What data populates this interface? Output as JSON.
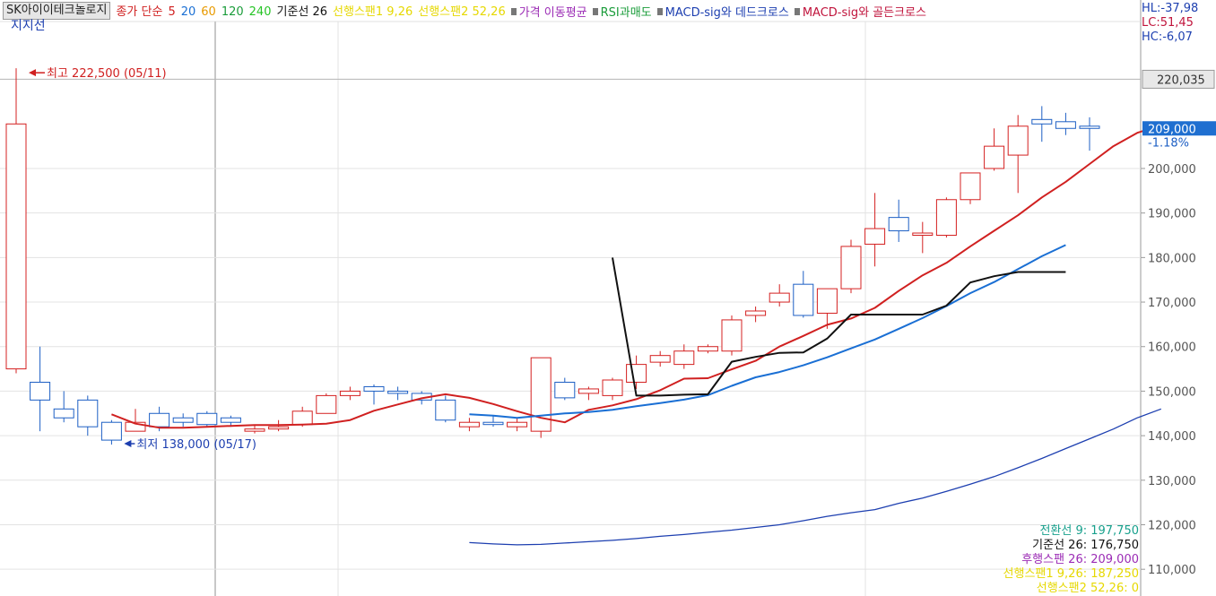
{
  "legend": {
    "title": "SK아이이테크놀로지",
    "items": [
      {
        "text": "종가 단순",
        "color": "#d02020"
      },
      {
        "text": "5",
        "color": "#d02020"
      },
      {
        "text": "20",
        "color": "#1a6fd4"
      },
      {
        "text": "60",
        "color": "#e89a00"
      },
      {
        "text": "120",
        "color": "#1a9c3a"
      },
      {
        "text": "240",
        "color": "#26c426"
      },
      {
        "text": "기준선 26",
        "color": "#111111"
      },
      {
        "text": "선행스팬1 9,26",
        "color": "#e6d800"
      },
      {
        "text": "선행스팬2 52,26",
        "color": "#e6d800"
      },
      {
        "text": "가격 이동평균",
        "color": "#9b2bb5",
        "marker": true
      },
      {
        "text": "RSI과매도",
        "color": "#1a9c3a",
        "marker": true
      },
      {
        "text": "MACD-sig와 데드크로스",
        "color": "#1d3fb0",
        "marker": true
      },
      {
        "text": "MACD-sig와 골든크로스",
        "color": "#c0143c",
        "marker": true
      }
    ]
  },
  "indicator_label": "지지선",
  "right_stats": [
    {
      "text": "HL:-37,98",
      "color": "#1d3fb0"
    },
    {
      "text": "LC:51,45",
      "color": "#c0143c"
    },
    {
      "text": "HC:-6,07",
      "color": "#1d3fb0"
    }
  ],
  "bottom_info": [
    {
      "text": "전환선 9: 197,750",
      "color": "#17a08c"
    },
    {
      "text": "기준선 26: 176,750",
      "color": "#111111"
    },
    {
      "text": "후행스팬 26: 209,000",
      "color": "#9b2bb5"
    },
    {
      "text": "선행스팬1 9,26: 187,250",
      "color": "#e6d800"
    },
    {
      "text": "선행스팬2 52,26: 0",
      "color": "#e6d800"
    }
  ],
  "chart_data": {
    "type": "candlestick",
    "yaxis": {
      "ticks": [
        "110,000",
        "120,000",
        "130,000",
        "140,000",
        "150,000",
        "160,000",
        "170,000",
        "180,000",
        "190,000",
        "200,000"
      ],
      "tick_values": [
        110000,
        120000,
        130000,
        140000,
        150000,
        160000,
        170000,
        180000,
        190000,
        200000
      ],
      "ylim": [
        104000,
        233000
      ],
      "max_marker": {
        "value": 220035,
        "label": "220,035"
      },
      "current": {
        "value": 209000,
        "label": "209,000",
        "change": "-1.18%"
      }
    },
    "annotations": {
      "high": {
        "text": "최고 222,500 (05/11)",
        "value": 222500,
        "index": 0
      },
      "low": {
        "text": "최저 138,000 (05/17)",
        "value": 138000,
        "index": 4
      }
    },
    "candles": [
      {
        "o": 155000,
        "h": 222500,
        "l": 154000,
        "c": 210000
      },
      {
        "o": 152000,
        "h": 160000,
        "l": 141000,
        "c": 148000
      },
      {
        "o": 146000,
        "h": 150000,
        "l": 143000,
        "c": 144000
      },
      {
        "o": 148000,
        "h": 149000,
        "l": 140000,
        "c": 142000
      },
      {
        "o": 143000,
        "h": 143500,
        "l": 138000,
        "c": 139000
      },
      {
        "o": 141000,
        "h": 146000,
        "l": 141000,
        "c": 143000
      },
      {
        "o": 145000,
        "h": 146500,
        "l": 141000,
        "c": 142000
      },
      {
        "o": 144000,
        "h": 145000,
        "l": 142000,
        "c": 143000
      },
      {
        "o": 145000,
        "h": 145500,
        "l": 142000,
        "c": 142500
      },
      {
        "o": 144000,
        "h": 144500,
        "l": 142000,
        "c": 143000
      },
      {
        "o": 141000,
        "h": 142500,
        "l": 140500,
        "c": 141500
      },
      {
        "o": 141500,
        "h": 143500,
        "l": 141000,
        "c": 142000
      },
      {
        "o": 142500,
        "h": 146500,
        "l": 142000,
        "c": 145500
      },
      {
        "o": 145000,
        "h": 149500,
        "l": 145000,
        "c": 149000
      },
      {
        "o": 149000,
        "h": 151000,
        "l": 148000,
        "c": 150000
      },
      {
        "o": 151000,
        "h": 151500,
        "l": 147000,
        "c": 150000
      },
      {
        "o": 150000,
        "h": 151000,
        "l": 148000,
        "c": 149500
      },
      {
        "o": 149500,
        "h": 150000,
        "l": 147000,
        "c": 148000
      },
      {
        "o": 148000,
        "h": 149000,
        "l": 143000,
        "c": 143500
      },
      {
        "o": 142000,
        "h": 144000,
        "l": 141000,
        "c": 143000
      },
      {
        "o": 143000,
        "h": 144500,
        "l": 142000,
        "c": 142500
      },
      {
        "o": 142000,
        "h": 144000,
        "l": 141000,
        "c": 143000
      },
      {
        "o": 141000,
        "h": 157500,
        "l": 139500,
        "c": 157500
      },
      {
        "o": 152000,
        "h": 153000,
        "l": 148000,
        "c": 148500
      },
      {
        "o": 149500,
        "h": 151000,
        "l": 148000,
        "c": 150500
      },
      {
        "o": 149000,
        "h": 153000,
        "l": 148000,
        "c": 152500
      },
      {
        "o": 152000,
        "h": 158000,
        "l": 150500,
        "c": 156000
      },
      {
        "o": 156500,
        "h": 159000,
        "l": 155500,
        "c": 158000
      },
      {
        "o": 156000,
        "h": 160500,
        "l": 155000,
        "c": 159000
      },
      {
        "o": 159000,
        "h": 160500,
        "l": 158500,
        "c": 160000
      },
      {
        "o": 159000,
        "h": 167000,
        "l": 158000,
        "c": 166000
      },
      {
        "o": 167000,
        "h": 169000,
        "l": 165500,
        "c": 168000
      },
      {
        "o": 170000,
        "h": 174000,
        "l": 169000,
        "c": 172000
      },
      {
        "o": 174000,
        "h": 177000,
        "l": 166500,
        "c": 167000
      },
      {
        "o": 167500,
        "h": 173000,
        "l": 164000,
        "c": 173000
      },
      {
        "o": 173000,
        "h": 184000,
        "l": 172000,
        "c": 182500
      },
      {
        "o": 183000,
        "h": 194500,
        "l": 178000,
        "c": 186500
      },
      {
        "o": 189000,
        "h": 193000,
        "l": 183500,
        "c": 186000
      },
      {
        "o": 185000,
        "h": 188000,
        "l": 181000,
        "c": 185500
      },
      {
        "o": 185000,
        "h": 193500,
        "l": 184500,
        "c": 193000
      },
      {
        "o": 193000,
        "h": 199000,
        "l": 192000,
        "c": 199000
      },
      {
        "o": 200000,
        "h": 209000,
        "l": 199500,
        "c": 205000
      },
      {
        "o": 203000,
        "h": 212000,
        "l": 194500,
        "c": 209500
      },
      {
        "o": 211000,
        "h": 214000,
        "l": 206000,
        "c": 210000
      },
      {
        "o": 210500,
        "h": 212500,
        "l": 207500,
        "c": 209000
      },
      {
        "o": 209500,
        "h": 211500,
        "l": 204000,
        "c": 209000
      }
    ],
    "series": [
      {
        "name": "5",
        "color": "#d02020",
        "start": 4,
        "values": [
          144800,
          142700,
          141800,
          141800,
          142000,
          142200,
          142400,
          142400,
          142500,
          142700,
          143500,
          145600,
          147000,
          148400,
          149300,
          148500,
          147100,
          145500,
          144000,
          143000,
          145800,
          146800,
          148200,
          150200,
          152800,
          152900,
          154900,
          156800,
          160000,
          162400,
          164900,
          166300,
          168700,
          172500,
          176000,
          178800,
          182500,
          186000,
          189500,
          193500,
          197000,
          201000,
          205000,
          208000,
          209700,
          209200
        ]
      },
      {
        "name": "20",
        "color": "#1a6fd4",
        "start": 19,
        "values": [
          144800,
          144500,
          144000,
          144500,
          145000,
          145300,
          145800,
          146600,
          147300,
          148100,
          149100,
          151200,
          153100,
          154300,
          155800,
          157600,
          159600,
          161600,
          164000,
          166400,
          169100,
          172000,
          174500,
          177400,
          180300,
          182800
        ]
      },
      {
        "name": "기준선 26",
        "color": "#111111",
        "start": 25,
        "values": [
          180000,
          149000,
          149000,
          149200,
          149300,
          156600,
          157700,
          158600,
          158700,
          161800,
          167200,
          167200,
          167200,
          167200,
          169200,
          174400,
          175800,
          176750,
          176750,
          176750
        ]
      },
      {
        "name": "60",
        "color": "#1d3fb0",
        "start": 19,
        "values": [
          116000,
          115700,
          115500,
          115600,
          115900,
          116200,
          116500,
          116900,
          117400,
          117800,
          118300,
          118800,
          119400,
          120000,
          120900,
          121900,
          122700,
          123400,
          124800,
          126000,
          127500,
          129100,
          130800,
          132800,
          134900,
          137100,
          139300,
          141500,
          144000,
          146000
        ]
      }
    ]
  }
}
